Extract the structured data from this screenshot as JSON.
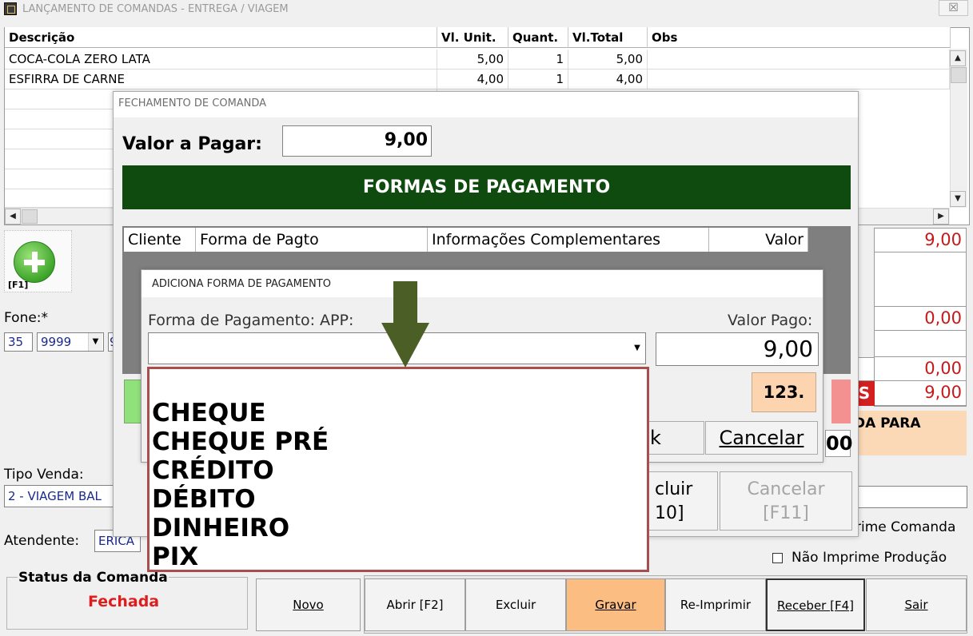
{
  "window": {
    "title": "LANÇAMENTO DE COMANDAS - ENTREGA / VIAGEM",
    "close_glyph": "☒"
  },
  "grid": {
    "columns": [
      "Descrição",
      "Vl. Unit.",
      "Quant.",
      "Vl.Total",
      "Obs"
    ],
    "rows": [
      {
        "desc": "COCA-COLA ZERO LATA",
        "unit": "5,00",
        "qty": "1",
        "total": "5,00",
        "obs": ""
      },
      {
        "desc": "ESFIRRA DE CARNE",
        "unit": "4,00",
        "qty": "1",
        "total": "4,00",
        "obs": ""
      }
    ]
  },
  "add": {
    "shortcut": "[F1]",
    "icon": "plus-circle-icon"
  },
  "fone": {
    "label": "Fone:*",
    "ddd": "35",
    "prefix": "9999",
    "rest": "9"
  },
  "tipo_venda": {
    "label": "Tipo Venda:",
    "value": "2 - VIAGEM BAL"
  },
  "atendente": {
    "label": "Atendente:",
    "value": "ERICA"
  },
  "status": {
    "title": "Status da Comanda",
    "value": "Fechada"
  },
  "totals": {
    "v1": "9,00",
    "v2": "0,00",
    "v3": "0,00",
    "v4": "9,00",
    "s_mark": "S",
    "warn": "DA PARA"
  },
  "right_labels": {
    "colon": ":",
    "imprime_comanda": "rime Comanda",
    "nao_imprime_producao": "Não Imprime Produção",
    "partial_00": "00"
  },
  "buttons": {
    "novo": "Novo",
    "abrir": "Abrir [F2]",
    "excluir": "Excluir",
    "gravar": "Gravar",
    "reimprimir": "Re-Imprimir",
    "receber": "Receber [F4]",
    "sair": "Sair"
  },
  "fechamento": {
    "title": "FECHAMENTO DE COMANDA",
    "valor_label": "Valor a Pagar:",
    "valor": "9,00",
    "banner": "FORMAS DE PAGAMENTO",
    "columns": [
      "Cliente",
      "Forma de Pagto",
      "Informações Complementares",
      "Valor"
    ],
    "excluir_line1": "cluir",
    "excluir_line2": "10]",
    "cancelar_line1": "Cancelar",
    "cancelar_line2": "[F11]"
  },
  "adiciona": {
    "title": "ADICIONA FORMA DE PAGAMENTO",
    "forma_label": "Forma de Pagamento:",
    "forma_hint": "APP:",
    "valor_label": "Valor Pago:",
    "valor": "9,00",
    "num_button": "123.",
    "ok_label": "k",
    "cancel_label": "Cancelar",
    "options": [
      "CHEQUE",
      "CHEQUE PRÉ",
      "CRÉDITO",
      "DÉBITO",
      "DINHEIRO",
      "PIX"
    ]
  },
  "colors": {
    "banner": "#0f4a0f",
    "status": "#e01d1d",
    "totals": "#c41a1a",
    "gravar": "#fbbd82",
    "arrow": "#4b5e25",
    "dropdown_border": "#a94d4d"
  }
}
